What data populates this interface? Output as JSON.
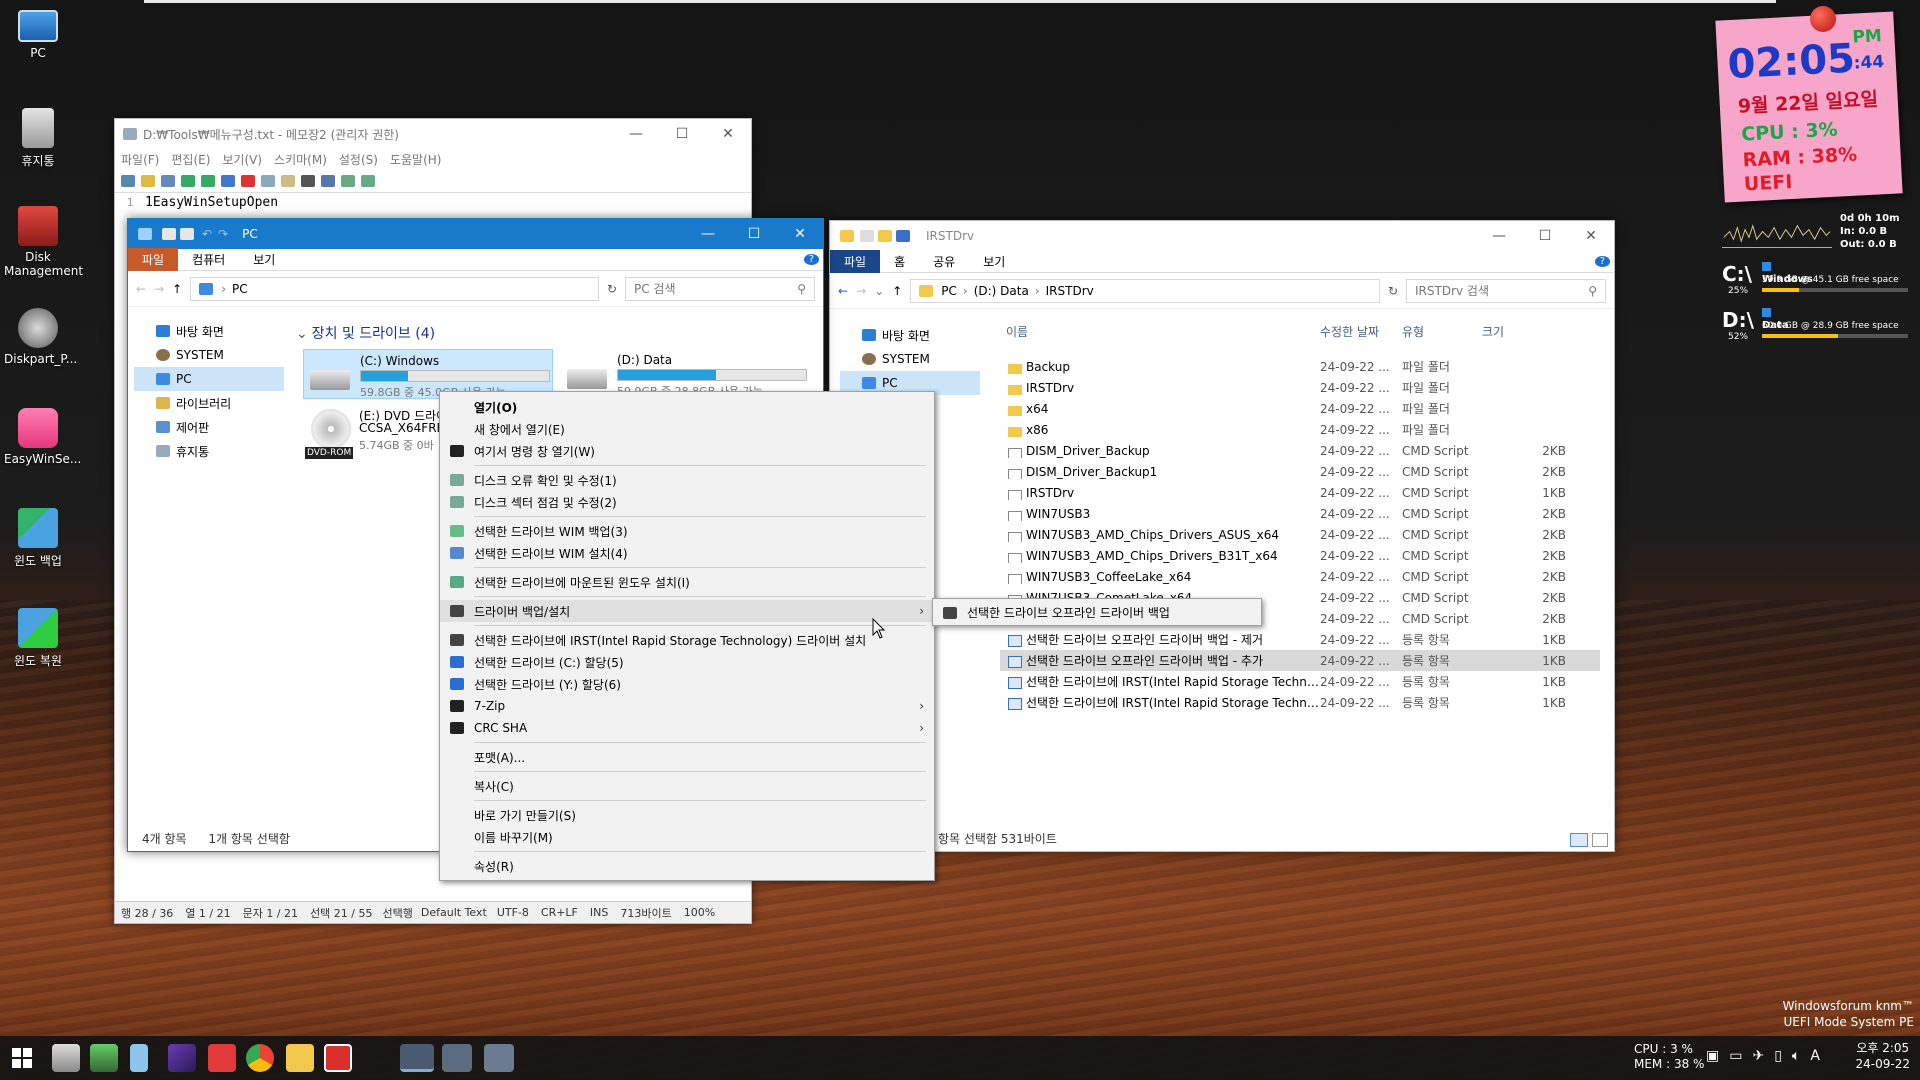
{
  "desktop_icons": [
    {
      "label": "PC",
      "icon": "pc-icon"
    },
    {
      "label": "휴지통",
      "icon": "recycle-bin-icon"
    },
    {
      "label": "Disk Management",
      "icon": "disk-management-icon"
    },
    {
      "label": "Diskpart_P...",
      "icon": "diskpart-icon"
    },
    {
      "label": "EasyWinSe...",
      "icon": "easywinsetup-icon"
    },
    {
      "label": "윈도 백업",
      "icon": "windows-backup-icon"
    },
    {
      "label": "윈도 복원",
      "icon": "windows-restore-icon"
    }
  ],
  "clock_widget": {
    "time": "02:05",
    "seconds": ":44",
    "ampm": "PM",
    "date": "9월 22일 일요일",
    "cpu": "CPU : 3%",
    "ram": "RAM : 38%",
    "mode": "UEFI"
  },
  "net_widget": {
    "uptime": "0d 0h 10m",
    "in": "In: 0.0 B",
    "out": "Out: 0.0 B"
  },
  "drives_widget": [
    {
      "letter": "C:\\",
      "pct": "25%",
      "name": "Windows",
      "info": "59.9 GB @ 45.1 GB free space",
      "fill": 0.25
    },
    {
      "letter": "D:\\",
      "pct": "52%",
      "name": "Data",
      "info": "60.0 GB @ 28.9 GB free space",
      "fill": 0.52
    }
  ],
  "notepad": {
    "title": "D:₩Tools₩메뉴구성.txt - 메모장2 (관리자 권한)",
    "menu": [
      "파일(F)",
      "편집(E)",
      "보기(V)",
      "스키마(M)",
      "설정(S)",
      "도움말(H)"
    ],
    "line_no": "1",
    "line_text": "1EasyWinSetupOpen",
    "status": [
      "행 28 / 36",
      "열 1 / 21",
      "문자 1 / 21",
      "선택 21 / 55",
      "선택행",
      "Default Text",
      "UTF-8",
      "CR+LF",
      "INS",
      "713바이트",
      "100%"
    ]
  },
  "explorer_pc": {
    "title": "PC",
    "ribbon": [
      "파일",
      "컴퓨터",
      "보기"
    ],
    "address": "PC",
    "search": "PC 검색",
    "nav": [
      "바탕 화면",
      "SYSTEM",
      "PC",
      "라이브러리",
      "제어판",
      "휴지통"
    ],
    "group": "장치 및 드라이브 (4)",
    "drives": [
      {
        "name": "(C:) Windows",
        "info": "59.8GB 중 45.0GB 사용 가능",
        "fill": 0.25
      },
      {
        "name": "(D:) Data",
        "info": "59.9GB 중 28.8GB 사용 가능",
        "fill": 0.52
      },
      {
        "name": "(E:) DVD 드라이",
        "sub": "CCSA_X64FRE_",
        "info": "5.74GB 중 0바",
        "badge": "DVD-ROM"
      }
    ],
    "status_items": "4개 항목",
    "status_selected": "1개 항목 선택함"
  },
  "explorer_irst": {
    "title": "IRSTDrv",
    "ribbon": [
      "파일",
      "홈",
      "공유",
      "보기"
    ],
    "breadcrumb": [
      "PC",
      "(D:) Data",
      "IRSTDrv"
    ],
    "search": "IRSTDrv 검색",
    "nav": [
      "바탕 화면",
      "SYSTEM",
      "PC"
    ],
    "columns": [
      "이름",
      "수정한 날짜",
      "유형",
      "크기"
    ],
    "files": [
      {
        "name": "Backup",
        "date": "24-09-22 ...",
        "type": "파일 폴더",
        "size": "",
        "kind": "folder"
      },
      {
        "name": "IRSTDrv",
        "date": "24-09-22 ...",
        "type": "파일 폴더",
        "size": "",
        "kind": "folder"
      },
      {
        "name": "x64",
        "date": "24-09-22 ...",
        "type": "파일 폴더",
        "size": "",
        "kind": "folder"
      },
      {
        "name": "x86",
        "date": "24-09-22 ...",
        "type": "파일 폴더",
        "size": "",
        "kind": "folder"
      },
      {
        "name": "DISM_Driver_Backup",
        "date": "24-09-22 ...",
        "type": "CMD Script",
        "size": "2KB",
        "kind": "cmd"
      },
      {
        "name": "DISM_Driver_Backup1",
        "date": "24-09-22 ...",
        "type": "CMD Script",
        "size": "2KB",
        "kind": "cmd"
      },
      {
        "name": "IRSTDrv",
        "date": "24-09-22 ...",
        "type": "CMD Script",
        "size": "1KB",
        "kind": "cmd"
      },
      {
        "name": "WIN7USB3",
        "date": "24-09-22 ...",
        "type": "CMD Script",
        "size": "2KB",
        "kind": "cmd"
      },
      {
        "name": "WIN7USB3_AMD_Chips_Drivers_ASUS_x64",
        "date": "24-09-22 ...",
        "type": "CMD Script",
        "size": "2KB",
        "kind": "cmd"
      },
      {
        "name": "WIN7USB3_AMD_Chips_Drivers_B31T_x64",
        "date": "24-09-22 ...",
        "type": "CMD Script",
        "size": "2KB",
        "kind": "cmd"
      },
      {
        "name": "WIN7USB3_CoffeeLake_x64",
        "date": "24-09-22 ...",
        "type": "CMD Script",
        "size": "2KB",
        "kind": "cmd"
      },
      {
        "name": "WIN7USB3_CometLake_x64",
        "date": "24-09-22 ...",
        "type": "CMD Script",
        "size": "2KB",
        "kind": "cmd"
      },
      {
        "name": "",
        "date": "24-09-22 ...",
        "type": "CMD Script",
        "size": "2KB",
        "kind": "cmd"
      },
      {
        "name": "선택한 드라이브 오프라인 드라이버 백업 - 제거",
        "date": "24-09-22 ...",
        "type": "등록 항목",
        "size": "1KB",
        "kind": "reg"
      },
      {
        "name": "선택한 드라이브 오프라인 드라이버 백업 - 추가",
        "date": "24-09-22 ...",
        "type": "등록 항목",
        "size": "1KB",
        "kind": "reg",
        "selected": true
      },
      {
        "name": "선택한 드라이브에 IRST(Intel Rapid Storage Technol...",
        "date": "24-09-22 ...",
        "type": "등록 항목",
        "size": "1KB",
        "kind": "reg"
      },
      {
        "name": "선택한 드라이브에 IRST(Intel Rapid Storage Technol...",
        "date": "24-09-22 ...",
        "type": "등록 항목",
        "size": "1KB",
        "kind": "reg"
      }
    ],
    "status": "항목 선택함 531바이트"
  },
  "context_menu": [
    {
      "label": "열기(O)",
      "bold": true
    },
    {
      "label": "새 창에서 열기(E)"
    },
    {
      "label": "여기서 명령 창 열기(W)",
      "icon": "cmd-icon"
    },
    {
      "sep": true
    },
    {
      "label": "디스크 오류 확인 및 수정(1)",
      "icon": "disk-check-icon"
    },
    {
      "label": "디스크 섹터 점검 및 수정(2)",
      "icon": "disk-sector-icon"
    },
    {
      "sep": true
    },
    {
      "label": "선택한 드라이브 WIM 백업(3)",
      "icon": "wim-backup-icon"
    },
    {
      "label": "선택한 드라이브 WIM 설치(4)",
      "icon": "wim-install-icon"
    },
    {
      "sep": true
    },
    {
      "label": "선택한 드라이브에 마운트된 윈도우 설치(I)",
      "icon": "mount-install-icon"
    },
    {
      "sep": true
    },
    {
      "label": "드라이버 백업/설치",
      "icon": "driver-icon",
      "submenu": true,
      "highlight": true
    },
    {
      "sep": true
    },
    {
      "label": "선택한 드라이브에 IRST(Intel Rapid Storage Technology) 드라이버 설치",
      "icon": "irst-icon"
    },
    {
      "label": "선택한 드라이브 (C:) 할당(5)",
      "icon": "assign-icon"
    },
    {
      "label": "선택한 드라이브 (Y:) 할당(6)",
      "icon": "assign-icon"
    },
    {
      "label": "7-Zip",
      "icon": "7zip-icon",
      "submenu": true
    },
    {
      "label": "CRC SHA",
      "icon": "crc-icon",
      "submenu": true
    },
    {
      "sep": true
    },
    {
      "label": "포맷(A)..."
    },
    {
      "sep": true
    },
    {
      "label": "복사(C)"
    },
    {
      "sep": true
    },
    {
      "label": "바로 가기 만들기(S)"
    },
    {
      "label": "이름 바꾸기(M)"
    },
    {
      "sep": true
    },
    {
      "label": "속성(R)"
    }
  ],
  "submenu": {
    "label": "선택한 드라이브 오프라인 드라이버 백업"
  },
  "taskbar": {
    "cpu": "CPU : 3 %",
    "mem": "MEM : 38 %",
    "time": "오후 2:05",
    "date": "24-09-22",
    "ime": "A"
  },
  "watermark": {
    "line1": "Windowsforum knm™",
    "line2": "UEFI Mode System PE"
  }
}
